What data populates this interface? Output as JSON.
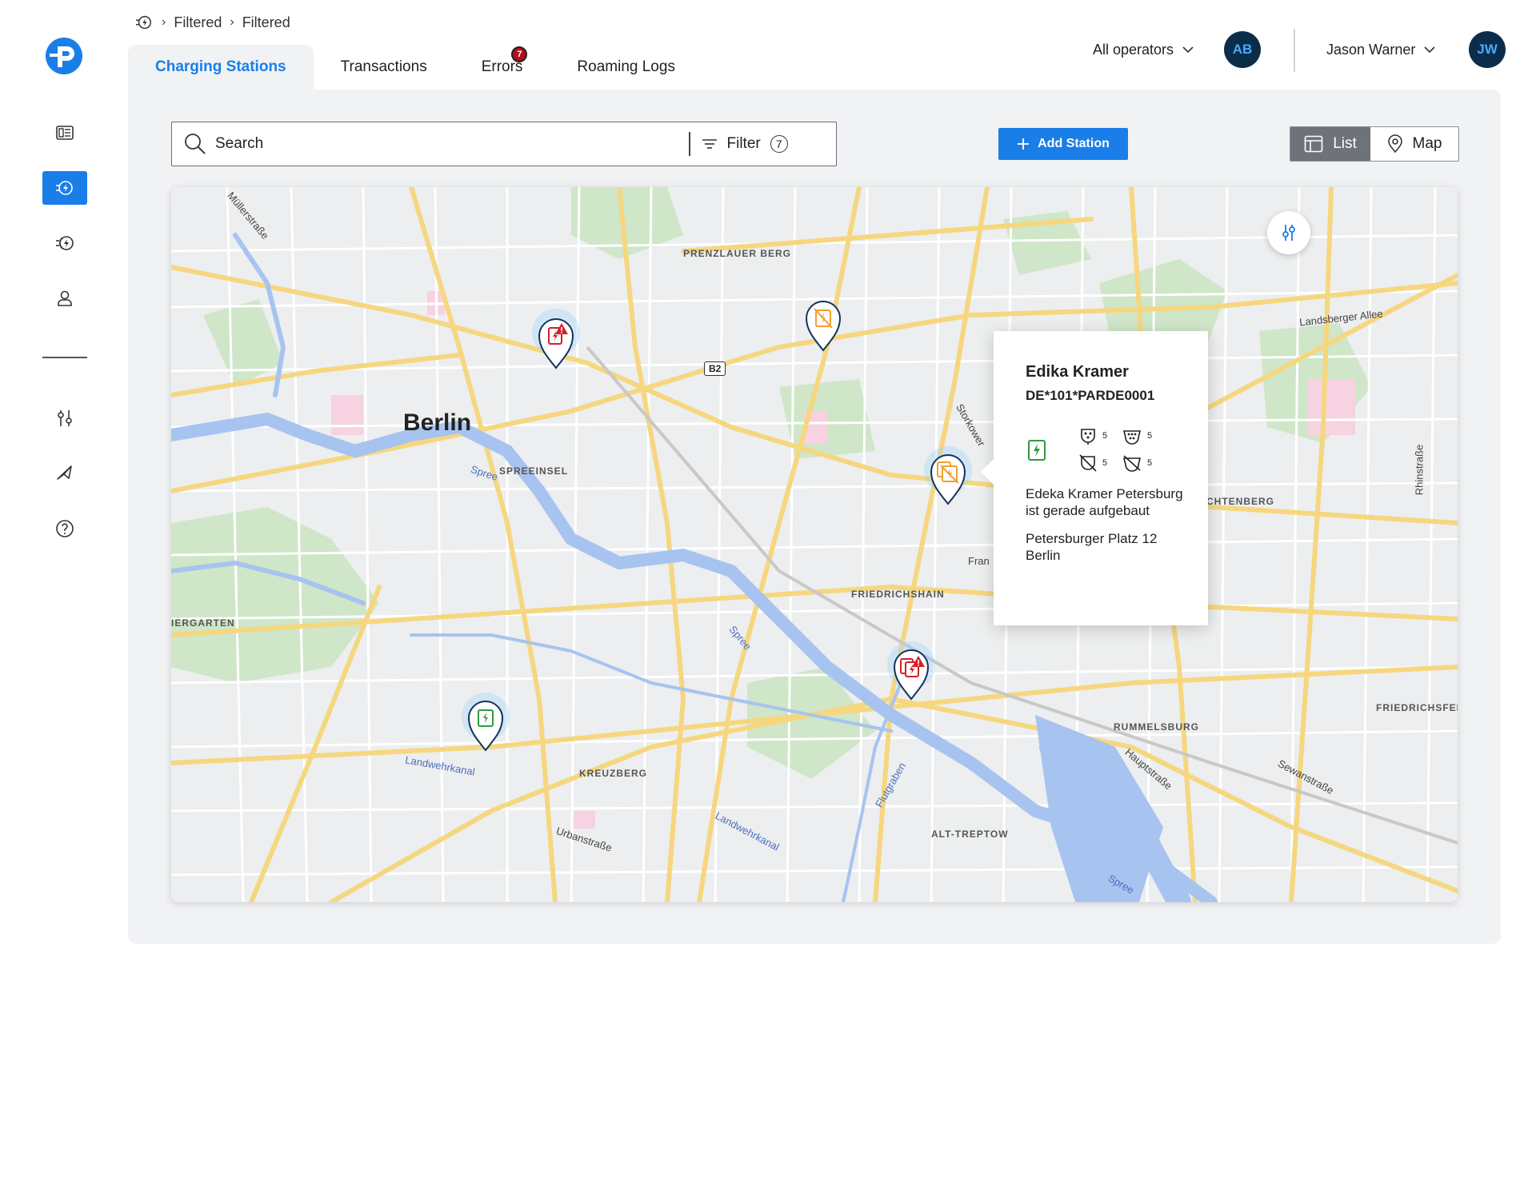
{
  "breadcrumb": {
    "items": [
      "Filtered",
      "Filtered"
    ]
  },
  "tabs": [
    {
      "label": "Charging Stations",
      "active": true
    },
    {
      "label": "Transactions",
      "active": false
    },
    {
      "label": "Errors",
      "active": false,
      "badge": "7"
    },
    {
      "label": "Roaming Logs",
      "active": false
    }
  ],
  "header": {
    "operators_label": "All operators",
    "operator_avatar": "AB",
    "user_name": "Jason Warner",
    "user_avatar": "JW"
  },
  "toolbar": {
    "search_placeholder": "Search",
    "filter_label": "Filter",
    "filter_count": "7",
    "add_station_label": "Add Station",
    "view_list_label": "List",
    "view_map_label": "Map",
    "selected_view": "List"
  },
  "sidebar": {
    "items": [
      {
        "icon": "dashboard-icon"
      },
      {
        "icon": "charging-station-icon",
        "active": true
      },
      {
        "icon": "charging-stations-group-icon"
      },
      {
        "icon": "user-icon"
      },
      {
        "icon": "sliders-icon"
      },
      {
        "icon": "send-icon"
      },
      {
        "icon": "help-icon"
      }
    ]
  },
  "map": {
    "labels": {
      "city": "Berlin",
      "prenzlauer": "PRENZLAUER BERG",
      "spreeinsel": "SPREEINSEL",
      "friedrichshain": "FRIEDRICHSHAIN",
      "kreuzberg": "KREUZBERG",
      "rummelsburg": "RUMMELSBURG",
      "alt_treptow": "ALT-TREPTOW",
      "tiergarten": "IERGARTEN",
      "lichtenberg": "CHTENBERG",
      "friedrichsfelde": "FRIEDRICHSFEL",
      "landsberger": "Landsberger Allee",
      "mullerstrasse": "Müllerstraße",
      "storkower": "Storkower",
      "frankfurter": "Fran",
      "landwehrkanal1": "Landwehrkanal",
      "landwehrkanal2": "Landwehrkanal",
      "urbanstrasse": "Urbanstraße",
      "flutgraben": "Flutgraben",
      "hauptstrasse": "Hauptstraße",
      "sewanstrasse": "Sewanstraße",
      "rhinstrasse": "Rhinstraße",
      "spree1": "Spree",
      "spree2": "Spree",
      "spree3": "Spree",
      "b2": "B2"
    },
    "markers": [
      {
        "status": "error",
        "color": "#d3202b"
      },
      {
        "status": "unavailable",
        "color": "#f0a030"
      },
      {
        "status": "unavailable-group",
        "color": "#f0a030"
      },
      {
        "status": "error-group",
        "color": "#d3202b"
      },
      {
        "status": "available",
        "color": "#2e9a3e"
      }
    ],
    "popup": {
      "title": "Edika Kramer",
      "id": "DE*101*PARDE0001",
      "connectors": [
        {
          "icon": "type2-plug-icon",
          "count": "5"
        },
        {
          "icon": "ccs-plug-icon",
          "count": "5"
        },
        {
          "icon": "plug-unavailable-icon",
          "count": "5"
        },
        {
          "icon": "plug-error-icon",
          "count": "5"
        }
      ],
      "description": "Edeka Kramer Petersburg ist gerade aufgebaut",
      "address_line1": "Petersburger Platz 12",
      "address_line2": "Berlin"
    }
  },
  "colors": {
    "accent": "#1a7ee8",
    "panel_bg": "#f1f2f4",
    "error": "#d3202b",
    "warning": "#f0a030",
    "available": "#2e9a3e",
    "avatar_bg": "#0c2d4a"
  }
}
